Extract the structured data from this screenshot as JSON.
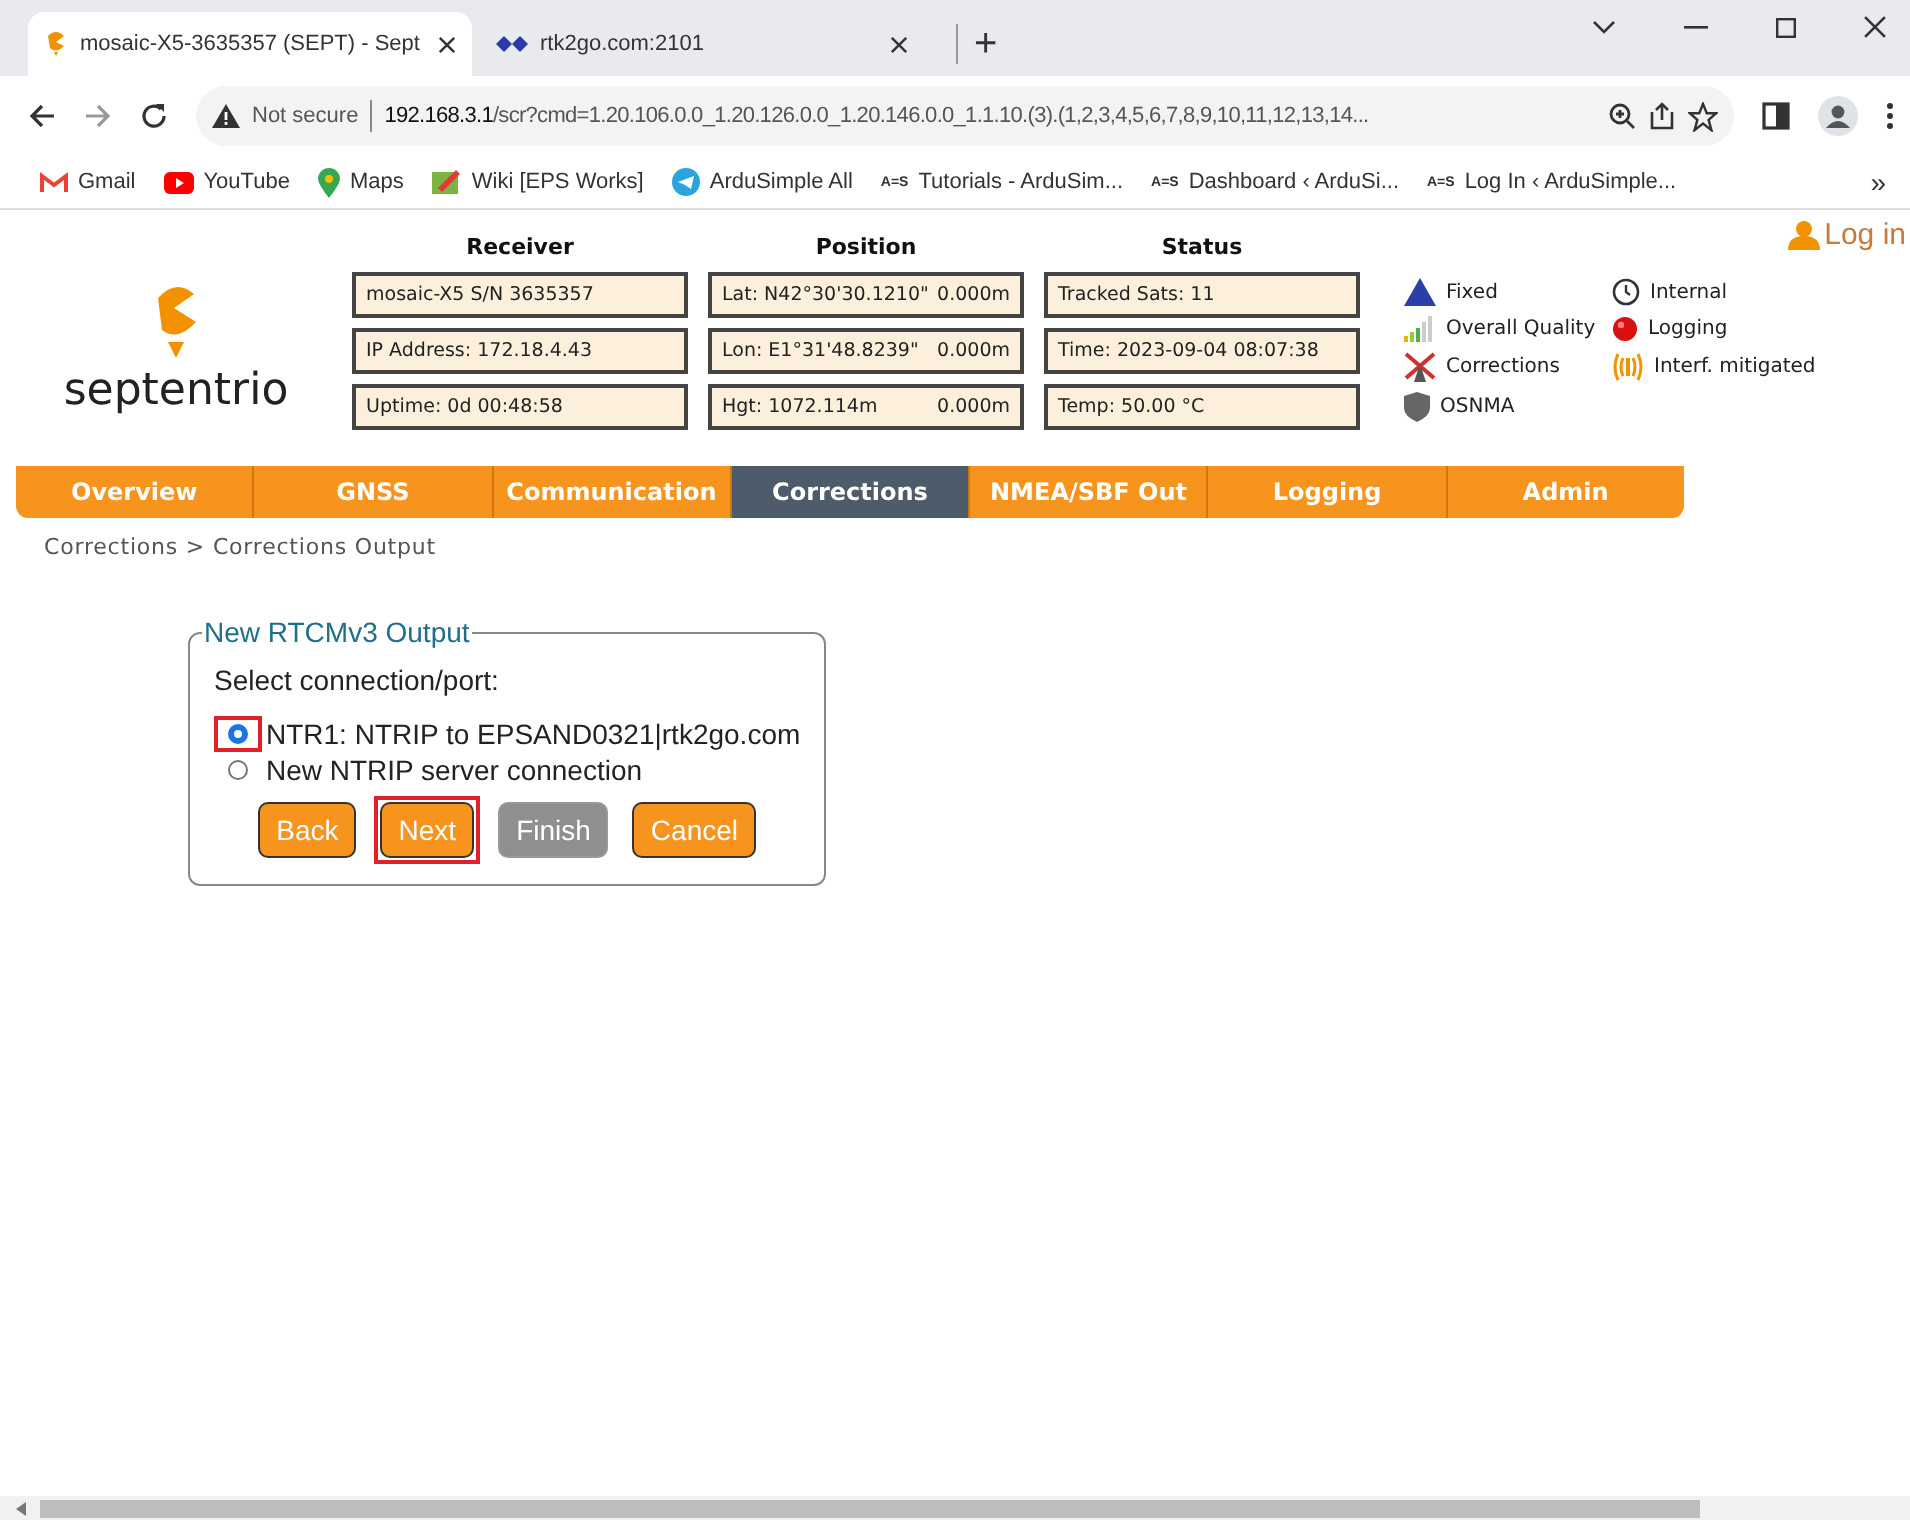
{
  "browser": {
    "tabs": [
      {
        "title": "mosaic-X5-3635357 (SEPT) - Sept",
        "selected": true
      },
      {
        "title": "rtk2go.com:2101",
        "selected": false
      }
    ],
    "new_tab": "+",
    "address": {
      "security": "Not secure",
      "host": "192.168.3.1",
      "path": "/scr?cmd=1.20.106.0.0_1.20.126.0.0_1.20.146.0.0_1.1.10.(3).(1,2,3,4,5,6,7,8,9,10,11,12,13,14..."
    },
    "bookmarks": [
      {
        "label": "Gmail"
      },
      {
        "label": "YouTube"
      },
      {
        "label": "Maps"
      },
      {
        "label": "Wiki [EPS Works]"
      },
      {
        "label": "ArduSimple All"
      },
      {
        "label": "Tutorials - ArduSim...",
        "logo_text": "A=S"
      },
      {
        "label": "Dashboard ‹ ArduSi...",
        "logo_text": "A=S"
      },
      {
        "label": "Log In ‹ ArduSimple...",
        "logo_text": "A=S"
      }
    ],
    "bookmarks_more": "»"
  },
  "header": {
    "logo": "septentrio",
    "login": "Log in",
    "receiver": {
      "title": "Receiver",
      "fields": [
        "mosaic-X5 S/N 3635357",
        "IP Address: 172.18.4.43",
        "Uptime: 0d 00:48:58"
      ]
    },
    "position": {
      "title": "Position",
      "fields": [
        {
          "value": "Lat:  N42°30'30.1210\"",
          "offset": "0.000m"
        },
        {
          "value": "Lon: E1°31'48.8239\"",
          "offset": "0.000m"
        },
        {
          "value": "Hgt: 1072.114m",
          "offset": "0.000m"
        }
      ]
    },
    "status": {
      "title": "Status",
      "fields": [
        "Tracked Sats: 11",
        "Time: 2023-09-04 08:07:38",
        "Temp: 50.00 °C"
      ]
    },
    "legend": [
      {
        "label": "Fixed"
      },
      {
        "label": "Internal"
      },
      {
        "label": "Overall Quality"
      },
      {
        "label": "Logging"
      },
      {
        "label": "Corrections"
      },
      {
        "label": "Interf. mitigated"
      },
      {
        "label": "OSNMA"
      }
    ]
  },
  "nav": [
    {
      "label": "Overview",
      "selected": false
    },
    {
      "label": "GNSS",
      "selected": false
    },
    {
      "label": "Communication",
      "selected": false
    },
    {
      "label": "Corrections",
      "selected": true
    },
    {
      "label": "NMEA/SBF Out",
      "selected": false
    },
    {
      "label": "Logging",
      "selected": false
    },
    {
      "label": "Admin",
      "selected": false
    }
  ],
  "breadcrumb": "Corrections > Corrections Output",
  "form": {
    "legend": "New RTCMv3 Output",
    "prompt": "Select connection/port:",
    "options": [
      {
        "label": "NTR1: NTRIP to EPSAND0321|rtk2go.com",
        "selected": true,
        "highlighted": true
      },
      {
        "label": "New NTRIP server connection",
        "selected": false,
        "highlighted": false
      }
    ],
    "buttons": [
      {
        "label": "Back",
        "disabled": false,
        "highlighted": false
      },
      {
        "label": "Next",
        "disabled": false,
        "highlighted": true
      },
      {
        "label": "Finish",
        "disabled": true,
        "highlighted": false
      },
      {
        "label": "Cancel",
        "disabled": false,
        "highlighted": false
      }
    ]
  }
}
